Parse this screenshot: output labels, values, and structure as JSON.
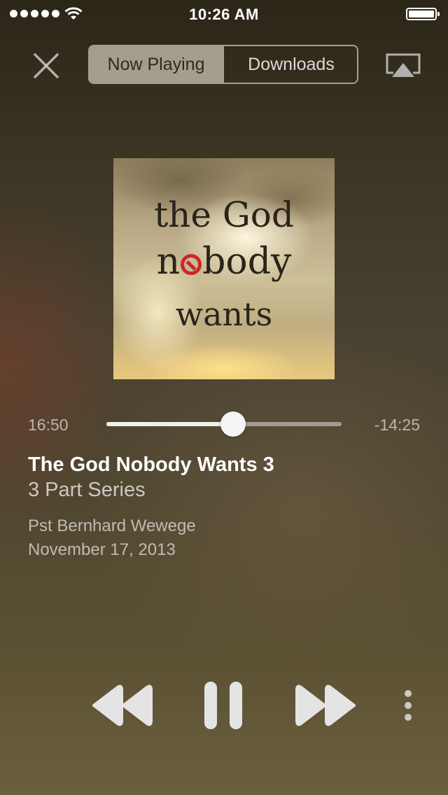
{
  "status_bar": {
    "time": "10:26 AM",
    "signal_icon": "signal-dots-icon",
    "wifi_icon": "wifi-icon",
    "battery_icon": "battery-full-icon"
  },
  "header": {
    "close_icon": "close-icon",
    "segments": [
      {
        "label": "Now Playing",
        "selected": true
      },
      {
        "label": "Downloads",
        "selected": false
      }
    ],
    "airplay_icon": "airplay-icon"
  },
  "artwork": {
    "line1": "the God",
    "line2_before": "n",
    "line2_after": "body",
    "line3": "wants"
  },
  "progress": {
    "elapsed": "16:50",
    "remaining": "-14:25",
    "fraction": 0.54
  },
  "track": {
    "title": "The God Nobody Wants 3",
    "series": "3 Part Series",
    "speaker": "Pst Bernhard Wewege",
    "date": "November 17, 2013"
  },
  "controls": {
    "rewind_icon": "rewind-icon",
    "pause_icon": "pause-icon",
    "forward_icon": "fast-forward-icon",
    "more_icon": "more-vertical-icon"
  },
  "colors": {
    "control": "#e4e4e4",
    "accent_red": "#c8282a"
  }
}
